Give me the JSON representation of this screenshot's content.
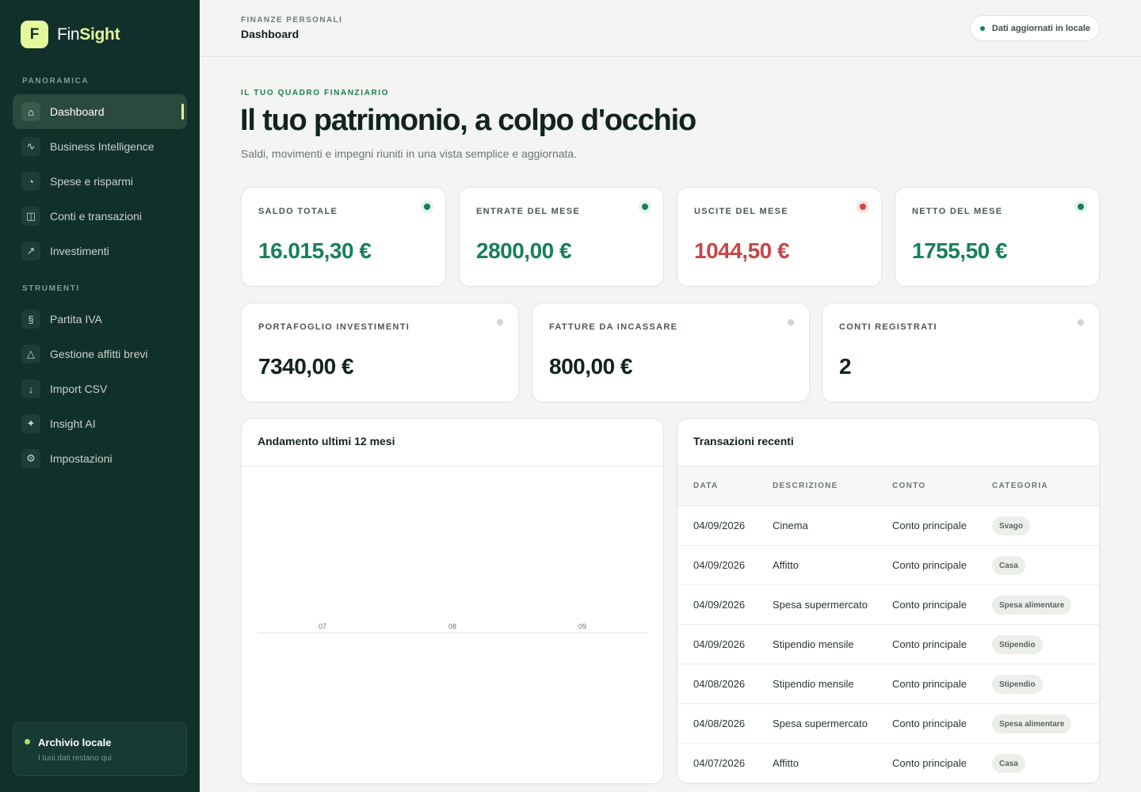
{
  "brand": {
    "logo_letter": "F",
    "name_part1": "Fin",
    "name_part2": "Sight"
  },
  "sidebar": {
    "section_overview": "PANORAMICA",
    "section_tools": "STRUMENTI",
    "overview_items": [
      {
        "label": "Dashboard",
        "icon": "⌂",
        "icon_name": "home-icon",
        "active": true
      },
      {
        "label": "Business Intelligence",
        "icon": "∿",
        "icon_name": "trend-icon"
      },
      {
        "label": "Spese e risparmi",
        "icon": "◔",
        "icon_name": "pie-icon"
      },
      {
        "label": "Conti e transazioni",
        "icon": "◫",
        "icon_name": "wallet-icon"
      },
      {
        "label": "Investimenti",
        "icon": "↗",
        "icon_name": "arrow-up-right-icon"
      }
    ],
    "tool_items": [
      {
        "label": "Partita IVA",
        "icon": "§",
        "icon_name": "section-icon"
      },
      {
        "label": "Gestione affitti brevi",
        "icon": "△",
        "icon_name": "triangle-icon"
      },
      {
        "label": "Import CSV",
        "icon": "↓",
        "icon_name": "download-icon"
      },
      {
        "label": "Insight AI",
        "icon": "✦",
        "icon_name": "sparkle-icon"
      },
      {
        "label": "Impostazioni",
        "icon": "⚙",
        "icon_name": "gear-icon"
      }
    ],
    "archive": {
      "title": "Archivio locale",
      "subtitle": "I tuoi dati restano qui"
    }
  },
  "header": {
    "kicker": "FINANZE PERSONALI",
    "title": "Dashboard",
    "status": "Dati aggiornati in locale"
  },
  "hero": {
    "kicker": "IL TUO QUADRO FINANZIARIO",
    "title": "Il tuo patrimonio, a colpo d'occhio",
    "subtitle": "Saldi, movimenti e impegni riuniti in una vista semplice e aggiornata."
  },
  "metrics_row1": [
    {
      "label": "SALDO TOTALE",
      "value": "16.015,30 €",
      "tone": "green"
    },
    {
      "label": "ENTRATE DEL MESE",
      "value": "2800,00 €",
      "tone": "green"
    },
    {
      "label": "USCITE DEL MESE",
      "value": "1044,50 €",
      "tone": "red"
    },
    {
      "label": "NETTO DEL MESE",
      "value": "1755,50 €",
      "tone": "green"
    }
  ],
  "metrics_row2": [
    {
      "label": "PORTAFOGLIO INVESTIMENTI",
      "value": "7340,00 €",
      "tone": "grey"
    },
    {
      "label": "FATTURE DA INCASSARE",
      "value": "800,00 €",
      "tone": "grey"
    },
    {
      "label": "CONTI REGISTRATI",
      "value": "2",
      "tone": "grey"
    }
  ],
  "colors": {
    "accent": "#e4f99a",
    "sidebar_bg": "#12302a",
    "positive": "#18805a",
    "negative": "#c94545"
  },
  "chart_panel": {
    "title": "Andamento ultimi 12 mesi",
    "chart_data": {
      "type": "bar",
      "categories": [
        "07",
        "08",
        "09"
      ],
      "values": [
        0,
        0,
        0
      ]
    }
  },
  "transactions": {
    "title": "Transazioni recenti",
    "columns": [
      "DATA",
      "DESCRIZIONE",
      "CONTO",
      "CATEGORIA"
    ],
    "rows": [
      {
        "date": "04/09/2026",
        "description": "Cinema",
        "account": "Conto principale",
        "category": "Svago"
      },
      {
        "date": "04/09/2026",
        "description": "Affitto",
        "account": "Conto principale",
        "category": "Casa"
      },
      {
        "date": "04/09/2026",
        "description": "Spesa supermercato",
        "account": "Conto principale",
        "category": "Spesa alimentare"
      },
      {
        "date": "04/09/2026",
        "description": "Stipendio mensile",
        "account": "Conto principale",
        "category": "Stipendio"
      },
      {
        "date": "04/08/2026",
        "description": "Stipendio mensile",
        "account": "Conto principale",
        "category": "Stipendio"
      },
      {
        "date": "04/08/2026",
        "description": "Spesa supermercato",
        "account": "Conto principale",
        "category": "Spesa alimentare"
      },
      {
        "date": "04/07/2026",
        "description": "Affitto",
        "account": "Conto principale",
        "category": "Casa"
      }
    ]
  }
}
